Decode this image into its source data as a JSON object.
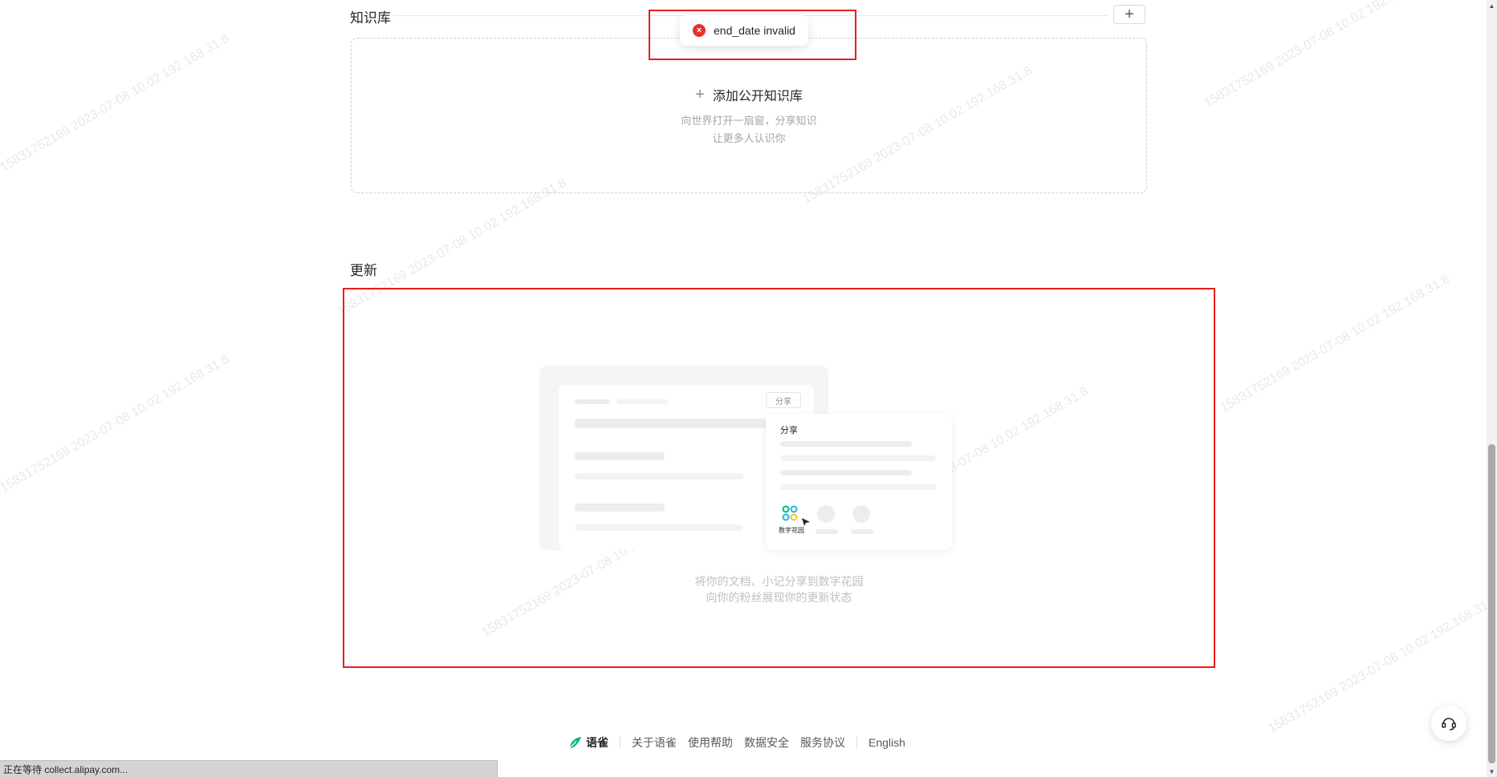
{
  "watermark": {
    "lines": [
      "15831752169  2023-07-08  10.02  192.168.31.8",
      "15831752169  2023-07-08  10.02  192.168.31.8",
      "15831752169  2023-07-08  10.02  192.168.31.8",
      "15831752169  2023-07-08  10.02  192.168.31.8",
      "15831752169  2023-07-08  10.02  192.168.31.8",
      "15831752169  2023-07-08  10.02  192.168.31.8",
      "15831752169  2023-07-08  10.02  192.168.31.8",
      "15831752169  2023-07-08  10.02  192.168.31.8",
      "15831752169  2023-07-08  10.02  192.168.31.8"
    ]
  },
  "knowledge_base": {
    "title": "知识库",
    "add_button_label": "+",
    "add_public_label": "添加公开知识库",
    "add_icon": "+",
    "desc_line1": "向世界打开一扇窗，分享知识",
    "desc_line2": "让更多人认识你"
  },
  "toast": {
    "icon": "error-circle-icon",
    "icon_glyph": "×",
    "message": "end_date invalid"
  },
  "updates": {
    "title": "更新",
    "illustration": {
      "share_tab": "分享",
      "share_card_title": "分享",
      "garden_label": "数字花园"
    },
    "empty_line1": "将你的文档、小记分享到数字花园",
    "empty_line2": "向你的粉丝展现你的更新状态"
  },
  "footer": {
    "brand": "语雀",
    "links": [
      "关于语雀",
      "使用帮助",
      "数据安全",
      "服务协议"
    ],
    "language": "English"
  },
  "status_bar": {
    "text": "正在等待 collect.alipay.com..."
  },
  "colors": {
    "highlight_frame": "#ec1c1c",
    "error": "#e5322d",
    "brand_green": "#00b96b"
  }
}
